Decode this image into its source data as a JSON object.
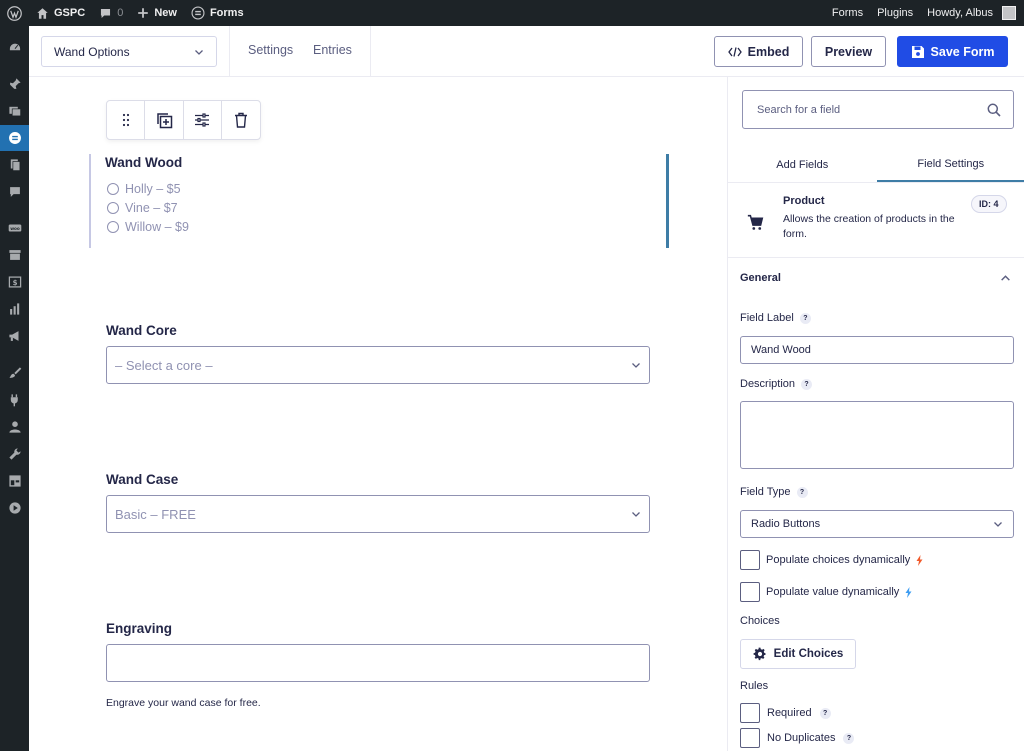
{
  "adminbar": {
    "site_name": "GSPC",
    "comments_count": "0",
    "new_label": "New",
    "forms_label": "Forms",
    "right_forms": "Forms",
    "right_plugins": "Plugins",
    "howdy": "Howdy, Albus"
  },
  "header": {
    "form_name": "Wand Options",
    "settings_tab": "Settings",
    "entries_tab": "Entries",
    "embed_label": "Embed",
    "preview_label": "Preview",
    "save_label": "Save Form"
  },
  "canvas": {
    "wand_wood": {
      "label": "Wand Wood",
      "choices": [
        "Holly – $5",
        "Vine – $7",
        "Willow – $9"
      ]
    },
    "wand_core": {
      "label": "Wand Core",
      "placeholder": "– Select a core –"
    },
    "wand_case": {
      "label": "Wand Case",
      "value": "Basic – FREE"
    },
    "engraving": {
      "label": "Engraving",
      "description": "Engrave your wand case for free."
    }
  },
  "sidebar": {
    "search_placeholder": "Search for a field",
    "tab_add_fields": "Add Fields",
    "tab_field_settings": "Field Settings",
    "product_title": "Product",
    "product_desc": "Allows the creation of products in the form.",
    "product_id": "ID: 4",
    "general_label": "General",
    "field_label_label": "Field Label",
    "field_label_value": "Wand Wood",
    "help_mark": "?",
    "description_label": "Description",
    "field_type_label": "Field Type",
    "field_type_value": "Radio Buttons",
    "populate_choices": "Populate choices dynamically",
    "populate_value": "Populate value dynamically",
    "choices_label": "Choices",
    "edit_choices": "Edit Choices",
    "rules_label": "Rules",
    "required_label": "Required",
    "no_duplicates_label": "No Duplicates"
  },
  "colors": {
    "admin_dark": "#1d2327",
    "admin_blue": "#2271b1",
    "primary": "#204ce5",
    "selected_bar": "#3e7da6"
  },
  "icons": {
    "wordpress": "wordpress-icon",
    "home": "home-icon",
    "comment": "comment-icon",
    "plus": "plus-icon",
    "forms": "forms-icon",
    "drag": "drag-handle-icon",
    "duplicate": "duplicate-icon",
    "settings": "sliders-icon",
    "delete": "trash-icon",
    "cart": "cart-icon",
    "gear": "gear-icon"
  }
}
